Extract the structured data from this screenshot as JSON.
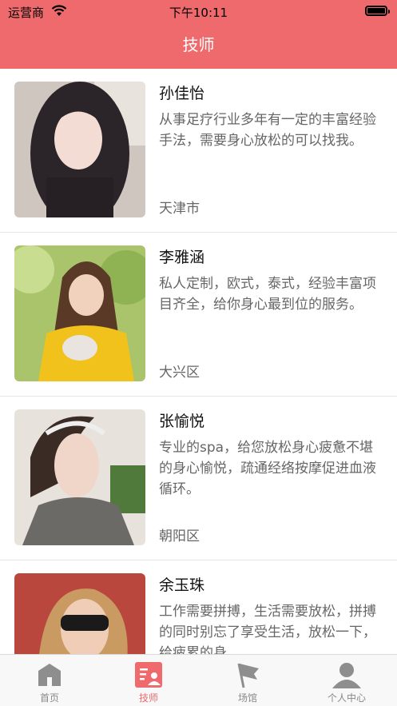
{
  "status_bar": {
    "carrier": "运营商",
    "time": "下午10:11"
  },
  "nav": {
    "title": "技师"
  },
  "technicians": [
    {
      "name": "孙佳怡",
      "description": "从事足疗行业多年有一定的丰富经验手法，需要身心放松的可以找我。",
      "area": "天津市"
    },
    {
      "name": "李雅涵",
      "description": "私人定制，欧式，泰式，经验丰富项目齐全，给你身心最到位的服务。",
      "area": "大兴区"
    },
    {
      "name": "张愉悦",
      "description": "专业的spa，给您放松身心疲惫不堪的身心愉悦，疏通经络按摩促进血液循环。",
      "area": "朝阳区"
    },
    {
      "name": "余玉珠",
      "description": "工作需要拼搏，生活需要放松，拼搏的同时别忘了享受生活，放松一下，给疲累的身...",
      "area": ""
    }
  ],
  "tabs": [
    {
      "label": "首页",
      "icon": "home-icon"
    },
    {
      "label": "技师",
      "icon": "technician-icon",
      "active": true
    },
    {
      "label": "场馆",
      "icon": "flag-icon"
    },
    {
      "label": "个人中心",
      "icon": "person-icon"
    }
  ],
  "colors": {
    "accent": "#ef6a6c",
    "tab_inactive": "#888888"
  }
}
